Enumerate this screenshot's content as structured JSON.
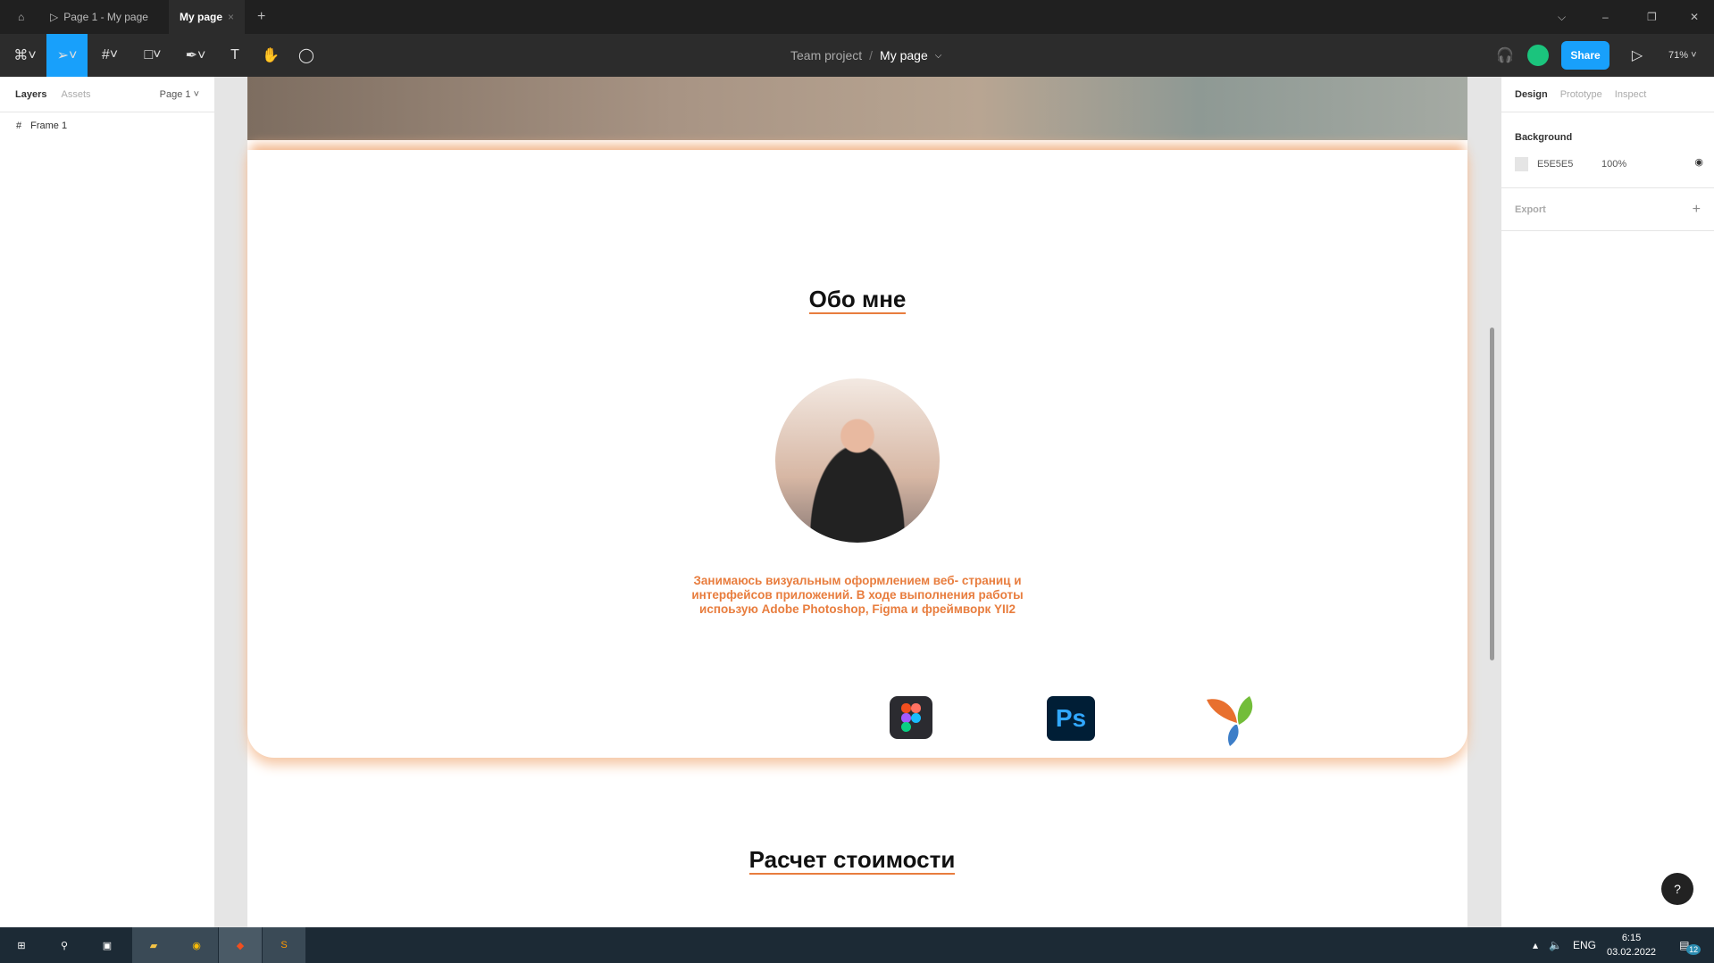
{
  "titlebar": {
    "tabs": [
      {
        "label": "Page 1 - My page"
      },
      {
        "label": "My page"
      }
    ]
  },
  "toolbar": {
    "breadcrumb_project": "Team project",
    "breadcrumb_sep": "/",
    "breadcrumb_page": "My page",
    "share_label": "Share",
    "zoom": "71%"
  },
  "left_panel": {
    "tabs": [
      "Layers",
      "Assets"
    ],
    "page_selector": "Page 1",
    "layers": [
      {
        "name": "Frame 1"
      }
    ]
  },
  "right_panel": {
    "tabs": [
      "Design",
      "Prototype",
      "Inspect"
    ],
    "background_label": "Background",
    "bg_color": "E5E5E5",
    "bg_opacity": "100%",
    "export_label": "Export"
  },
  "canvas": {
    "about_title": "Обо мне",
    "about_text": "Занимаюсь визуальным оформлением веб- страниц и интерфейсов приложений. В ходе выполнения работы испоьзую  Adobe Photoshop, Figma и фреймворк YII2",
    "ps_label": "Ps",
    "pricing_title": "Расчет стоимости",
    "accent": "#e87d3e"
  },
  "taskbar": {
    "lang": "ENG",
    "time": "6:15",
    "date": "03.02.2022",
    "notifications": "12"
  }
}
